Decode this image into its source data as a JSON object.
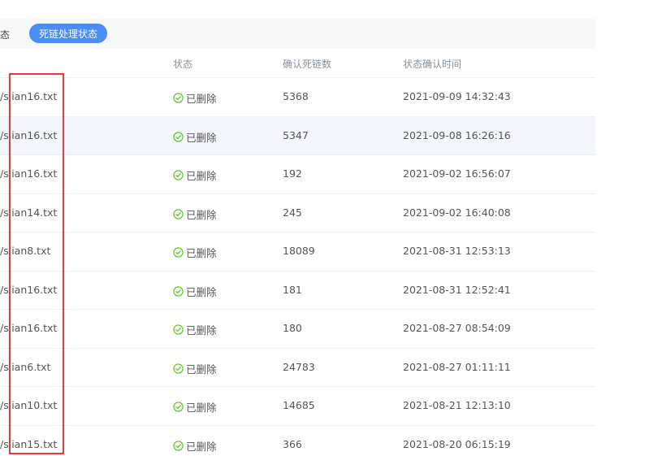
{
  "tabs": {
    "left_partial_label": "态",
    "active_label": "死链处理状态"
  },
  "table": {
    "columns": {
      "status": "状态",
      "count": "确认死链数",
      "time": "状态确认时间"
    },
    "rows": [
      {
        "file": "/siian16.txt",
        "status": "已删除",
        "count": "5368",
        "time": "2021-09-09 14:32:43"
      },
      {
        "file": "/siian16.txt",
        "status": "已删除",
        "count": "5347",
        "time": "2021-09-08 16:26:16"
      },
      {
        "file": "/siian16.txt",
        "status": "已删除",
        "count": "192",
        "time": "2021-09-02 16:56:07"
      },
      {
        "file": "/siian14.txt",
        "status": "已删除",
        "count": "245",
        "time": "2021-09-02 16:40:08"
      },
      {
        "file": "/siian8.txt",
        "status": "已删除",
        "count": "18089",
        "time": "2021-08-31 12:53:13"
      },
      {
        "file": "/siian16.txt",
        "status": "已删除",
        "count": "181",
        "time": "2021-08-31 12:52:41"
      },
      {
        "file": "/siian16.txt",
        "status": "已删除",
        "count": "180",
        "time": "2021-08-27 08:54:09"
      },
      {
        "file": "/siian6.txt",
        "status": "已删除",
        "count": "24783",
        "time": "2021-08-27 01:11:11"
      },
      {
        "file": "/siian10.txt",
        "status": "已删除",
        "count": "14685",
        "time": "2021-08-21 12:13:10"
      },
      {
        "file": "/siian15.txt",
        "status": "已删除",
        "count": "366",
        "time": "2021-08-20 06:15:19"
      }
    ]
  },
  "colors": {
    "accent": "#4a8df5",
    "success": "#52c41a",
    "annotation": "#e23b3b",
    "highlight_row": "#f3f6fd"
  },
  "icons": {
    "status": "check-circle-icon"
  }
}
